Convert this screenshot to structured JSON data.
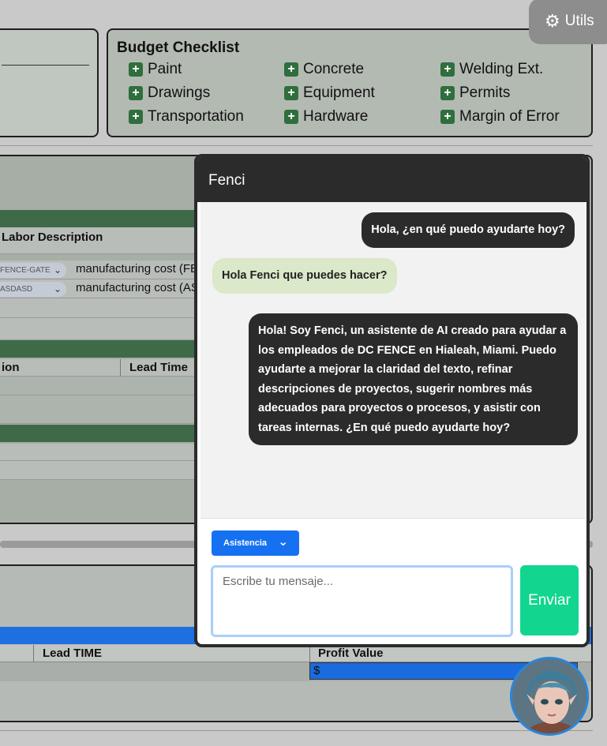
{
  "utils": {
    "label": "Utils",
    "icon": "gear-icon"
  },
  "budget": {
    "title": "Budget Checklist",
    "items": [
      "Paint",
      "Concrete",
      "Welding Ext.",
      "Drawings",
      "Equipment",
      "Permits",
      "Transportation",
      "Hardware",
      "Margin of Error"
    ]
  },
  "labor": {
    "header": "Labor Description",
    "rows": [
      {
        "select": "FENCE-GATE",
        "text": "manufacturing cost (FEN"
      },
      {
        "select": "ASDASD",
        "text": "manufacturing cost (AS"
      }
    ]
  },
  "table2": {
    "col1": "ion",
    "col2": "Lead Time"
  },
  "bottom": {
    "col1": "Lead TIME",
    "col2": "Profit Value",
    "profit_prefix": "$"
  },
  "chat": {
    "title": "Fenci",
    "messages": [
      {
        "role": "bot",
        "text": "Hola, ¿en qué puedo ayudarte hoy?"
      },
      {
        "role": "user",
        "text": "Hola Fenci que puedes hacer?"
      },
      {
        "role": "bot",
        "text": "Hola! Soy Fenci, un asistente de AI creado para ayudar a los empleados de DC FENCE en Hialeah, Miami. Puedo ayudarte a mejorar la claridad del texto, refinar descripciones de proyectos, sugerir nombres más adecuados para proyectos o procesos, y asistir con tareas internas. ¿En qué puedo ayudarte hoy?"
      }
    ],
    "mode": "Asistencia",
    "input_placeholder": "Escribe tu mensaje...",
    "send_label": "Enviar"
  },
  "colors": {
    "accent_blue": "#1571f2",
    "send_green": "#12d68f",
    "chat_dark": "#2b2b2b",
    "checklist_green": "#2f6e3d"
  }
}
